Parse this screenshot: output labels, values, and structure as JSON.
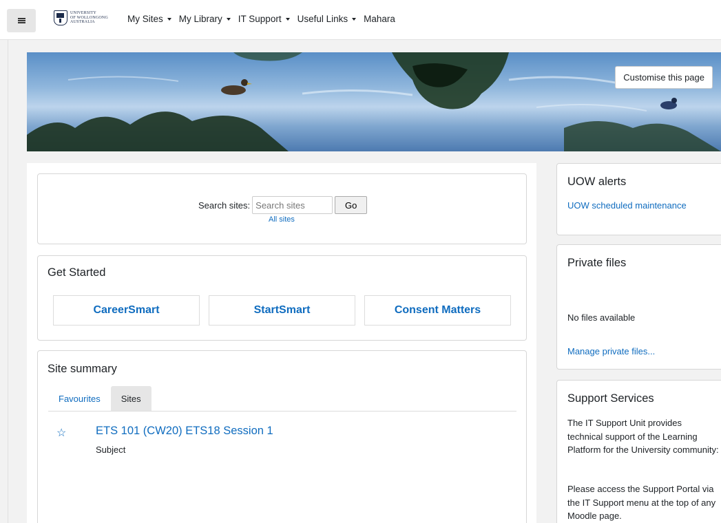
{
  "nav": {
    "logo_text": [
      "UNIVERSITY",
      "OF WOLLONGONG",
      "AUSTRALIA"
    ],
    "items": [
      {
        "label": "My Sites",
        "has_caret": true
      },
      {
        "label": "My Library",
        "has_caret": true
      },
      {
        "label": "IT Support",
        "has_caret": true
      },
      {
        "label": "Useful Links",
        "has_caret": true
      },
      {
        "label": "Mahara",
        "has_caret": false
      }
    ]
  },
  "banner": {
    "customise_label": "Customise this page"
  },
  "search": {
    "label": "Search sites:",
    "placeholder": "Search sites",
    "go_label": "Go",
    "all_sites_label": "All sites"
  },
  "get_started": {
    "title": "Get Started",
    "buttons": [
      "CareerSmart",
      "StartSmart",
      "Consent Matters"
    ]
  },
  "site_summary": {
    "title": "Site summary",
    "tabs": [
      {
        "label": "Favourites",
        "active": false
      },
      {
        "label": "Sites",
        "active": true
      }
    ],
    "courses": [
      {
        "name": "ETS 101 (CW20) ETS18 Session 1",
        "type": "Subject"
      }
    ]
  },
  "alerts": {
    "title": "UOW alerts",
    "link": "UOW scheduled maintenance"
  },
  "private_files": {
    "title": "Private files",
    "empty_text": "No files available",
    "manage_link": "Manage private files..."
  },
  "support": {
    "title": "Support Services",
    "paragraph1": "The IT Support Unit provides technical support of the Learning Platform for the University community:",
    "paragraph2": "Please access the Support Portal via the IT Support menu at the top of any Moodle page."
  },
  "colors": {
    "link": "#0f6cbf",
    "text": "#1d2125",
    "page_bg": "#f2f2f2",
    "tab_active_bg": "#e6e6e6"
  }
}
